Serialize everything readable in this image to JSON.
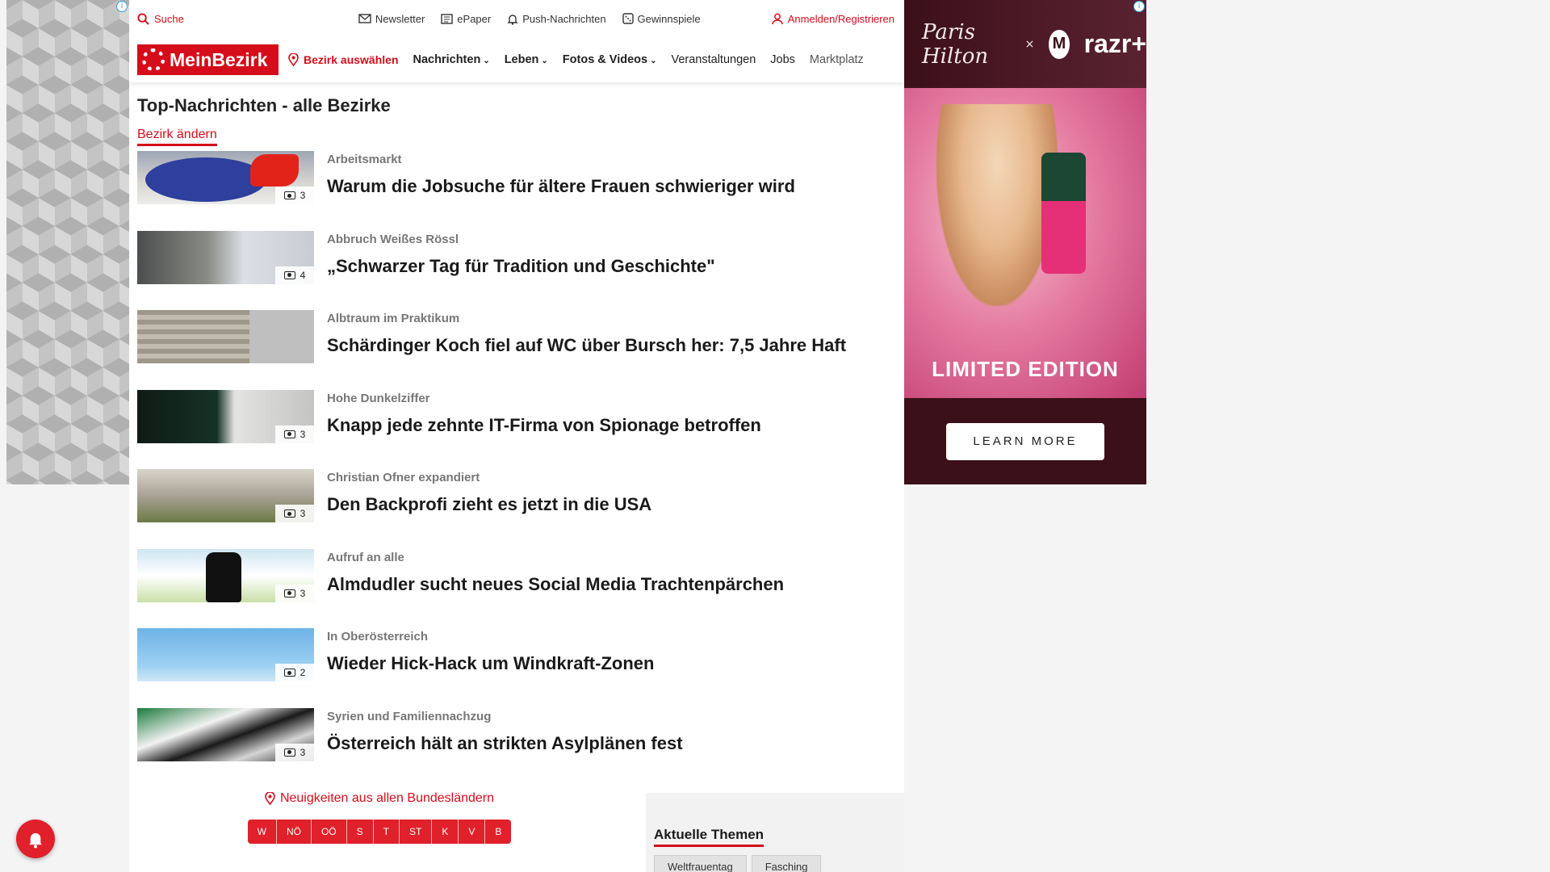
{
  "topbar": {
    "search_label": "Suche",
    "newsletter": "Newsletter",
    "epaper": "ePaper",
    "push": "Push-Nachrichten",
    "games": "Gewinnspiele",
    "login": "Anmelden/Registrieren"
  },
  "nav": {
    "logo": "MeinBezirk",
    "bezirk": "Bezirk auswählen",
    "links": [
      "Nachrichten",
      "Leben",
      "Fotos & Videos",
      "Veranstaltungen",
      "Jobs",
      "Marktplatz"
    ]
  },
  "page": {
    "title": "Top-Nachrichten - alle Bezirke",
    "change": "Bezirk ändern"
  },
  "articles": [
    {
      "kicker": "Arbeitsmarkt",
      "headline": "Warum die Jobsuche für ältere Frauen schwieriger wird",
      "images": "3"
    },
    {
      "kicker": "Abbruch Weißes Rössl",
      "headline": "„Schwarzer Tag für Tradition und Geschichte\"",
      "images": "4"
    },
    {
      "kicker": "Albtraum im Praktikum",
      "headline": "Schärdinger Koch fiel auf WC über Bursch her: 7,5 Jahre Haft",
      "images": ""
    },
    {
      "kicker": "Hohe Dunkelziffer",
      "headline": "Knapp jede zehnte IT-Firma von Spionage betroffen",
      "images": "3"
    },
    {
      "kicker": "Christian Ofner expandiert",
      "headline": "Den Backprofi zieht es jetzt in die USA",
      "images": "3"
    },
    {
      "kicker": "Aufruf an alle",
      "headline": "Almdudler sucht neues Social Media Trachtenpärchen",
      "images": "3"
    },
    {
      "kicker": "In Oberösterreich",
      "headline": "Wieder Hick-Hack um Windkraft-Zonen",
      "images": "2"
    },
    {
      "kicker": "Syrien und Familiennachzug",
      "headline": "Österreich hält an strikten Asylplänen fest",
      "images": "3"
    }
  ],
  "bundes": {
    "link": "Neuigkeiten aus allen Bundesländern",
    "states": [
      "W",
      "NÖ",
      "OÖ",
      "S",
      "T",
      "ST",
      "K",
      "V",
      "B"
    ]
  },
  "themes": {
    "title": "Aktuelle Themen",
    "tags": [
      "Weltfrauentag",
      "Fasching"
    ]
  },
  "ad": {
    "signature": "Paris Hilton",
    "x": "×",
    "brand": "razr+",
    "limited": "LIMITED EDITION",
    "cta": "LEARN MORE"
  },
  "colors": {
    "brand": "#d50d1b"
  }
}
